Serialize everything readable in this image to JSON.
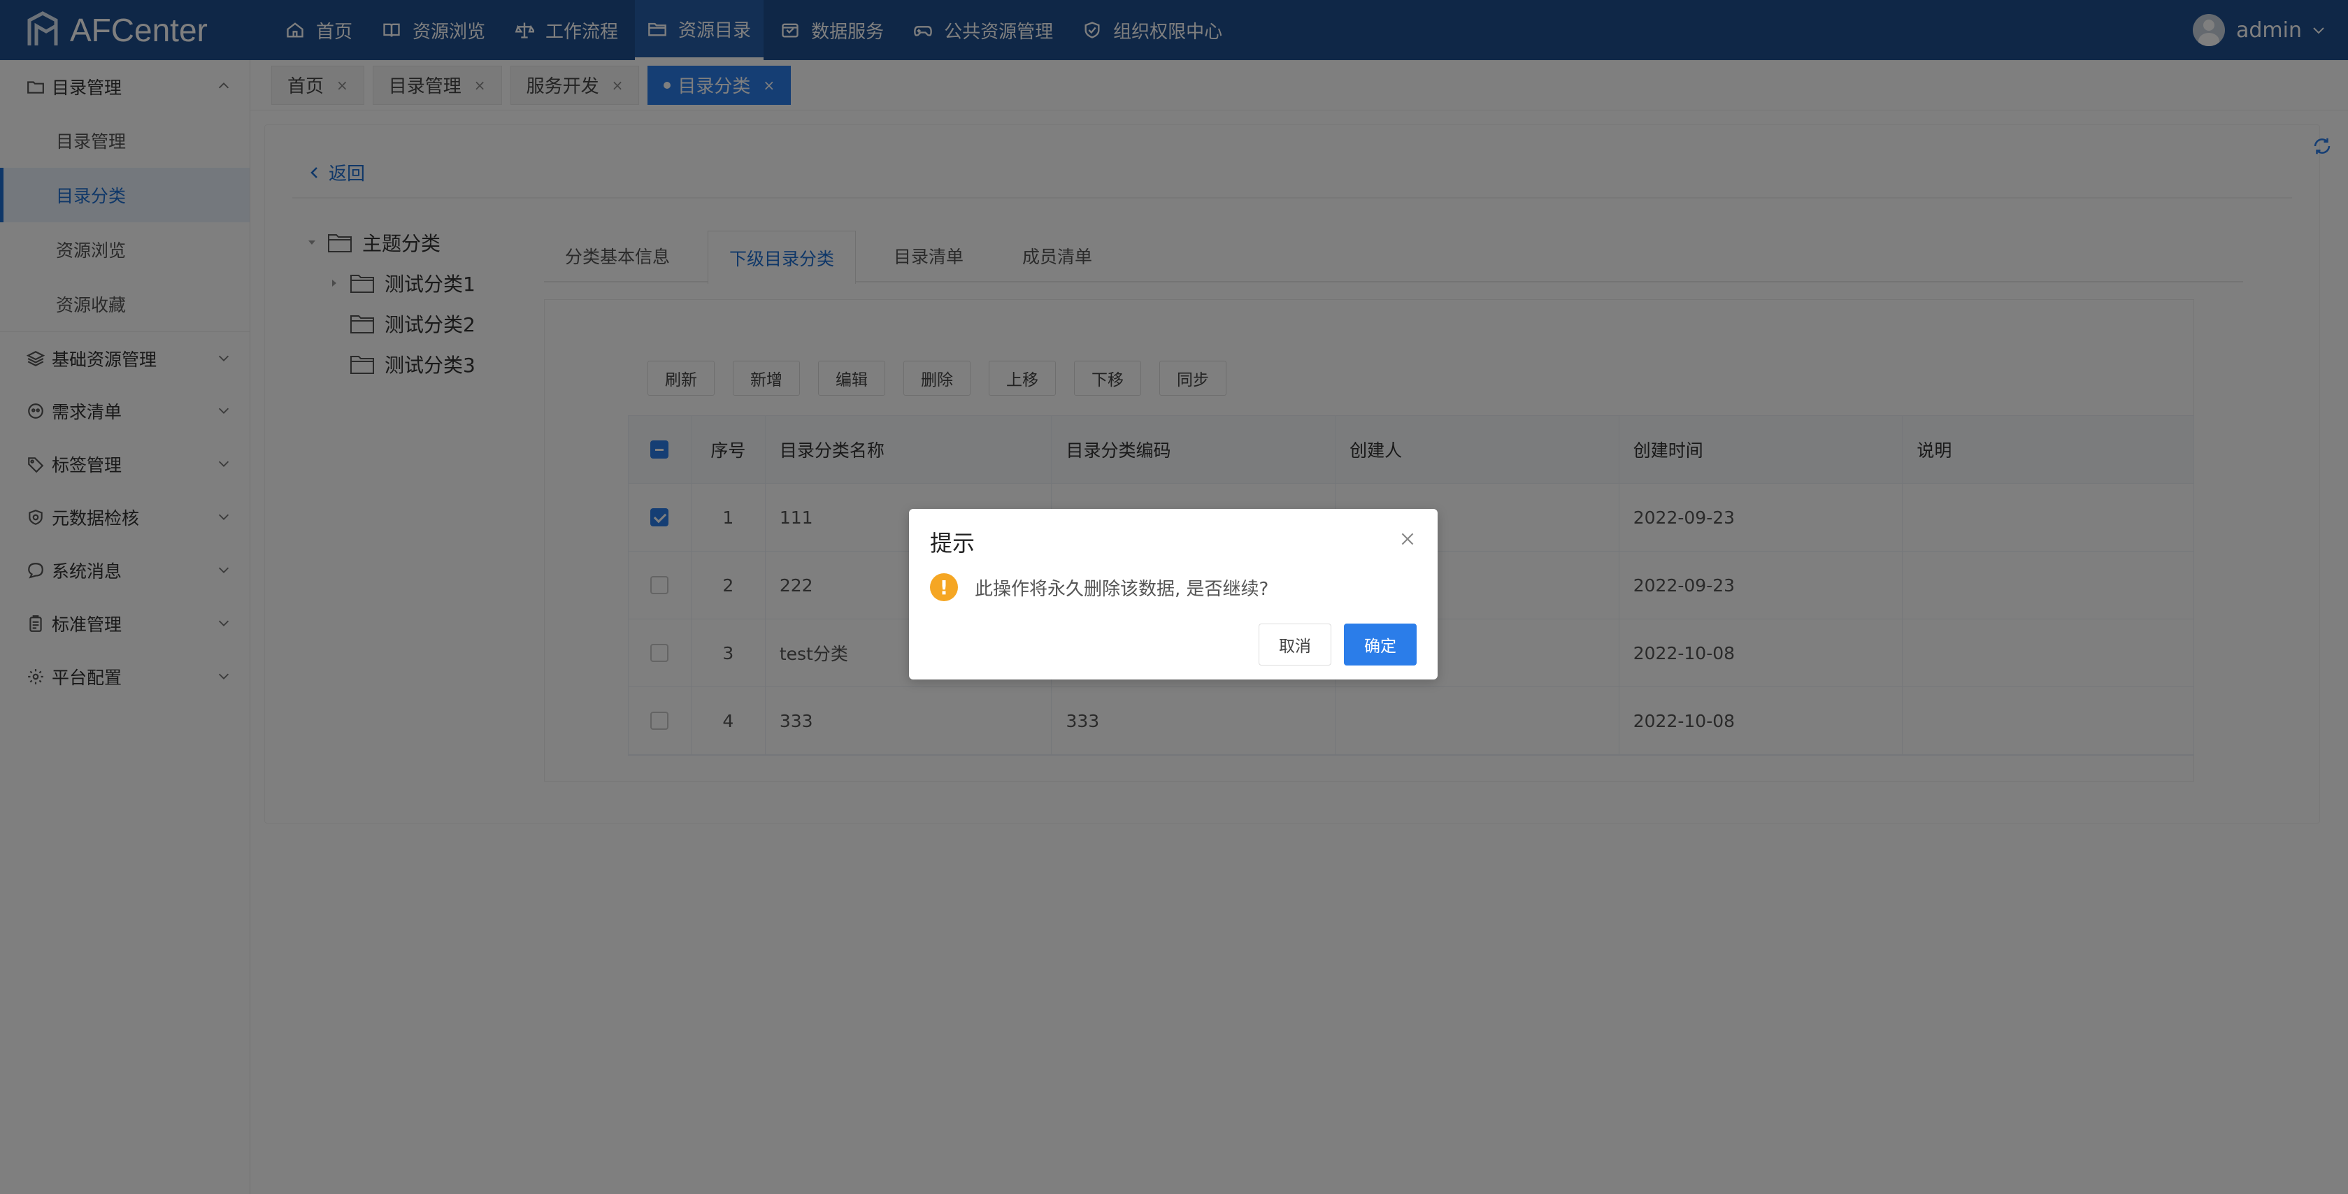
{
  "app": {
    "brand": "AFCenter"
  },
  "nav": [
    {
      "label": "首页",
      "icon": "home-icon"
    },
    {
      "label": "资源浏览",
      "icon": "book-icon"
    },
    {
      "label": "工作流程",
      "icon": "flow-icon"
    },
    {
      "label": "资源目录",
      "icon": "folder-icon",
      "active": true
    },
    {
      "label": "数据服务",
      "icon": "service-icon"
    },
    {
      "label": "公共资源管理",
      "icon": "gamepad-icon"
    },
    {
      "label": "组织权限中心",
      "icon": "shield-icon"
    }
  ],
  "user": {
    "name": "admin"
  },
  "sidebar": {
    "group_catalog": "目录管理",
    "items": [
      "目录管理",
      "目录分类",
      "资源浏览",
      "资源收藏"
    ],
    "groups": [
      "基础资源管理",
      "需求清单",
      "标签管理",
      "元数据检核",
      "系统消息",
      "标准管理",
      "平台配置"
    ]
  },
  "tabs": [
    {
      "label": "首页"
    },
    {
      "label": "目录管理"
    },
    {
      "label": "服务开发"
    },
    {
      "label": "目录分类",
      "active": true
    }
  ],
  "tab_close": "×",
  "content": {
    "back_label": "返回",
    "tree": {
      "root": "主题分类",
      "children": [
        "测试分类1",
        "测试分类2",
        "测试分类3"
      ]
    },
    "inner_tabs": [
      "分类基本信息",
      "下级目录分类",
      "目录清单",
      "成员清单"
    ],
    "toolbar": [
      "刷新",
      "新增",
      "编辑",
      "删除",
      "上移",
      "下移",
      "同步"
    ],
    "table": {
      "columns": [
        "序号",
        "目录分类名称",
        "目录分类编码",
        "创建人",
        "创建时间",
        "说明"
      ],
      "rows": [
        {
          "no": "1",
          "name": "111",
          "code": "",
          "creator": "",
          "time": "2022-09-23",
          "desc": ""
        },
        {
          "no": "2",
          "name": "222",
          "code": "",
          "creator": "",
          "time": "2022-09-23",
          "desc": ""
        },
        {
          "no": "3",
          "name": "test分类",
          "code": "",
          "creator": "",
          "time": "2022-10-08",
          "desc": ""
        },
        {
          "no": "4",
          "name": "333",
          "code": "333",
          "creator": "",
          "time": "2022-10-08",
          "desc": ""
        }
      ]
    }
  },
  "dialog": {
    "title": "提示",
    "message": "此操作将永久删除该数据, 是否继续?",
    "warn_symbol": "!",
    "cancel_label": "取消",
    "confirm_label": "确定"
  },
  "colors": {
    "header": "#1f4e8f",
    "primary": "#2b7de9",
    "warning": "#f5a623"
  }
}
